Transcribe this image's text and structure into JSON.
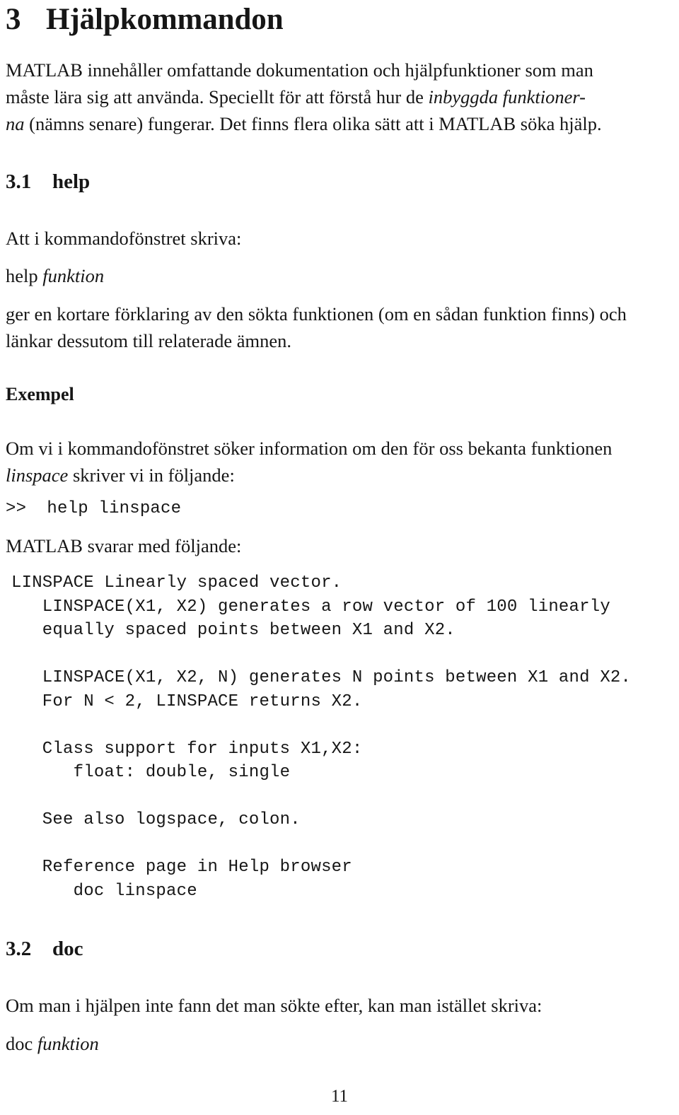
{
  "document": {
    "language": "sv",
    "page_number": "11",
    "text_color": "#161616",
    "background_color": "#ffffff"
  },
  "section": {
    "number": "3",
    "title": "Hjälpkommandon"
  },
  "intro": {
    "line1": "MATLAB innehåller omfattande dokumentation och hjälpfunktioner som man",
    "line2_a": "måste lära sig att använda. Speciellt för att förstå hur de ",
    "line2_em": "inbyggda funktioner-",
    "line3_em": "na",
    "line3_b": " (nämns senare) fungerar. Det finns flera olika sätt att i MATLAB söka hjälp."
  },
  "subsection_help": {
    "number": "3.1",
    "title": "help",
    "intro": "Att i kommandofönstret skriva:",
    "syntax_plain": "help ",
    "syntax_em": "funktion",
    "description_line1": "ger en kortare förklaring av den sökta funktionen (om en sådan funktion finns) och",
    "description_line2": "länkar dessutom till relaterade ämnen.",
    "example_heading": "Exempel",
    "example_intro_line1": "Om vi i kommandofönstret söker information om den för oss bekanta funktionen",
    "example_intro_em": "linspace",
    "example_intro_line2_rest": " skriver vi in följande:",
    "prompt_command": ">>  help linspace",
    "response_intro": "MATLAB svarar med följande:",
    "help_output": [
      "LINSPACE Linearly spaced vector.",
      "   LINSPACE(X1, X2) generates a row vector of 100 linearly",
      "   equally spaced points between X1 and X2.",
      "",
      "   LINSPACE(X1, X2, N) generates N points between X1 and X2.",
      "   For N < 2, LINSPACE returns X2.",
      "",
      "   Class support for inputs X1,X2:",
      "      float: double, single",
      "",
      "   See also logspace, colon.",
      "",
      "   Reference page in Help browser",
      "      doc linspace"
    ]
  },
  "subsection_doc": {
    "number": "3.2",
    "title": "doc",
    "intro": "Om man i hjälpen inte fann det man sökte efter, kan man istället skriva:",
    "syntax_plain": "doc ",
    "syntax_em": "funktion"
  }
}
